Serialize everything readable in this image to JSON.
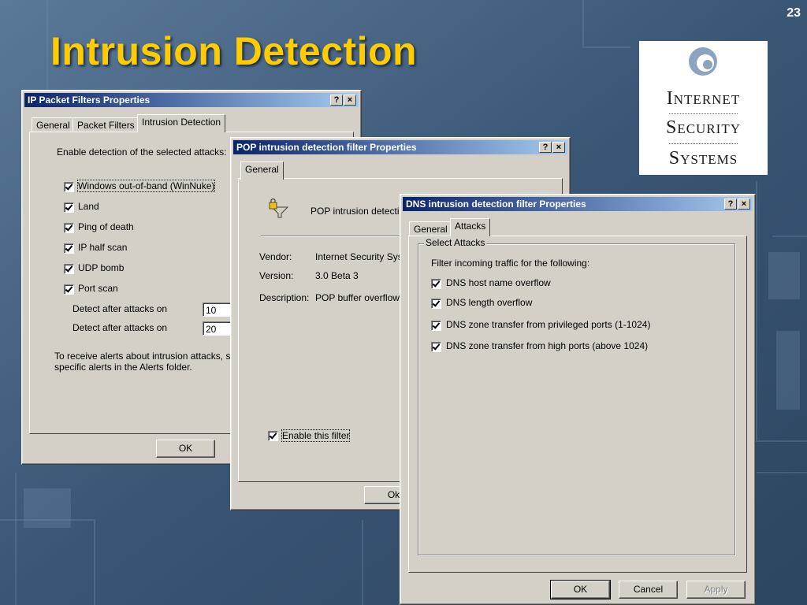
{
  "slide": {
    "title": "Intrusion Detection",
    "page_number": "23"
  },
  "logo": {
    "line1": "Internet",
    "line2": "Security",
    "line3": "Systems"
  },
  "ip_dialog": {
    "title": "IP Packet Filters Properties",
    "help_btn": "?",
    "close_btn": "×",
    "tabs": [
      "General",
      "Packet Filters",
      "Intrusion Detection"
    ],
    "intro": "Enable detection of the selected attacks:",
    "attacks": [
      "Windows out-of-band (WinNuke)",
      "Land",
      "Ping of death",
      "IP half scan",
      "UDP bomb",
      "Port scan"
    ],
    "detect_label_1": "Detect after attacks on",
    "detect_value_1": "10",
    "detect_label_2": "Detect after attacks on",
    "detect_value_2": "20",
    "alerts_line1": "To receive alerts about intrusion attacks, set",
    "alerts_line2": "specific alerts in the Alerts folder.",
    "ok": "OK"
  },
  "pop_dialog": {
    "title": "POP intrusion detection filter Properties",
    "help_btn": "?",
    "close_btn": "×",
    "tab": "General",
    "name": "POP intrusion detectio",
    "vendor_label": "Vendor:",
    "vendor_value": "Internet Security Syst",
    "version_label": "Version:",
    "version_value": "3.0 Beta 3",
    "description_label": "Description:",
    "description_value": "POP buffer overflow a",
    "enable_label": "Enable this filter",
    "ok": "Ok"
  },
  "dns_dialog": {
    "title": "DNS intrusion detection filter Properties",
    "help_btn": "?",
    "close_btn": "×",
    "tabs": [
      "General",
      "Attacks"
    ],
    "group_label": "Select Attacks",
    "intro": "Filter incoming traffic for the following:",
    "attacks": [
      "DNS host name overflow",
      "DNS length overflow",
      "DNS zone transfer from privileged ports (1-1024)",
      "DNS zone transfer from high ports (above 1024)"
    ],
    "ok": "OK",
    "cancel": "Cancel",
    "apply": "Apply"
  }
}
